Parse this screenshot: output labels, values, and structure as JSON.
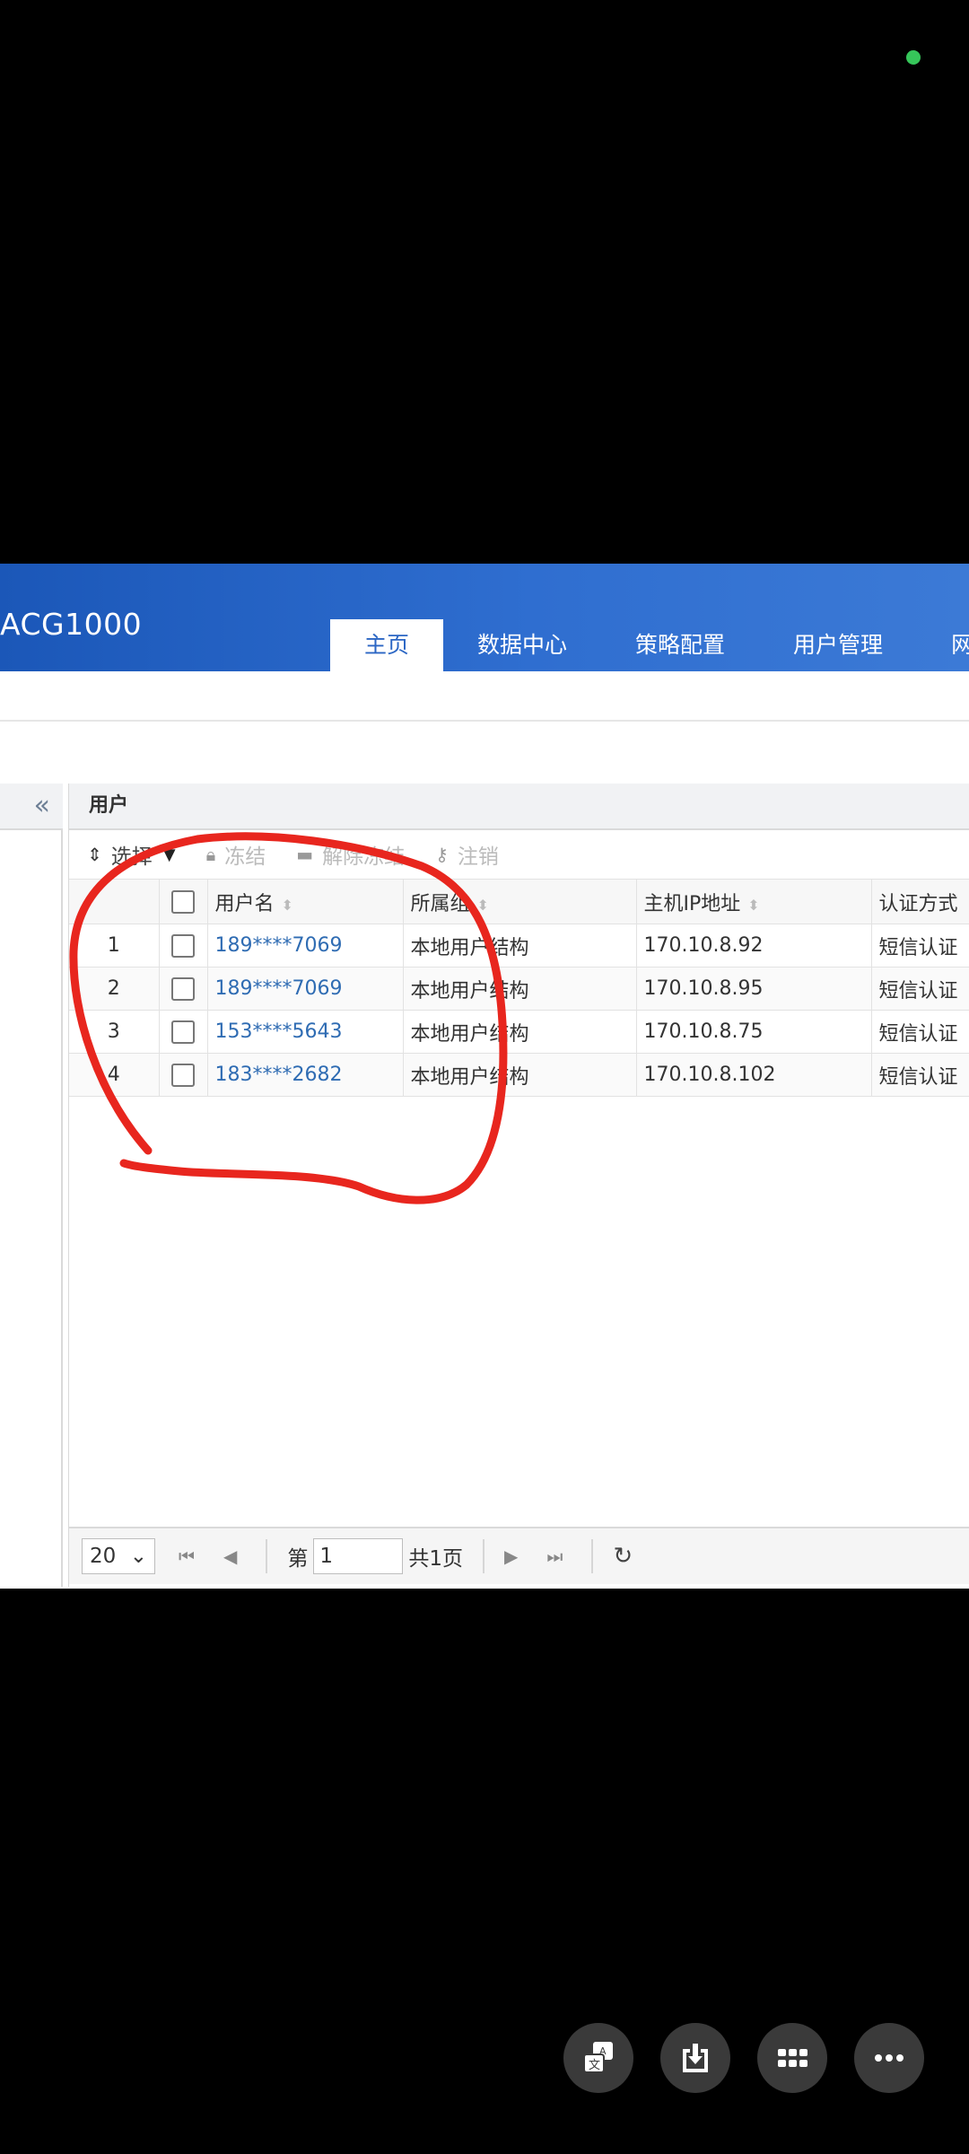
{
  "app": {
    "title": "ACG1000"
  },
  "nav": {
    "tabs": [
      {
        "label": "主页",
        "active": true
      },
      {
        "label": "数据中心",
        "active": false
      },
      {
        "label": "策略配置",
        "active": false
      },
      {
        "label": "用户管理",
        "active": false
      },
      {
        "label": "网络",
        "active": false
      }
    ]
  },
  "panel": {
    "title": "用户"
  },
  "toolbar": {
    "select_label": "选择",
    "freeze_label": "冻结",
    "unfreeze_label": "解除冻结",
    "logout_label": "注销"
  },
  "table": {
    "headers": {
      "username": "用户名",
      "group": "所属组",
      "ip": "主机IP地址",
      "auth": "认证方式"
    },
    "rows": [
      {
        "index": "1",
        "username": "189****7069",
        "group": "本地用户结构",
        "ip": "170.10.8.92",
        "auth": "短信认证"
      },
      {
        "index": "2",
        "username": "189****7069",
        "group": "本地用户结构",
        "ip": "170.10.8.95",
        "auth": "短信认证"
      },
      {
        "index": "3",
        "username": "153****5643",
        "group": "本地用户结构",
        "ip": "170.10.8.75",
        "auth": "短信认证"
      },
      {
        "index": "4",
        "username": "183****2682",
        "group": "本地用户结构",
        "ip": "170.10.8.102",
        "auth": "短信认证"
      }
    ]
  },
  "pager": {
    "page_size": "20",
    "page_prefix": "第",
    "current_page": "1",
    "total_pages": "共1页"
  },
  "colors": {
    "header_blue": "#2f6ed0",
    "link_blue": "#2f6cb3",
    "annotation_red": "#e8261e"
  },
  "icons": [
    "collapse-left-icon",
    "sort-icon",
    "lock-icon",
    "folder-icon",
    "key-icon",
    "first-page-icon",
    "prev-page-icon",
    "next-page-icon",
    "last-page-icon",
    "refresh-icon",
    "translate-icon",
    "download-icon",
    "grid-icon",
    "more-icon"
  ]
}
